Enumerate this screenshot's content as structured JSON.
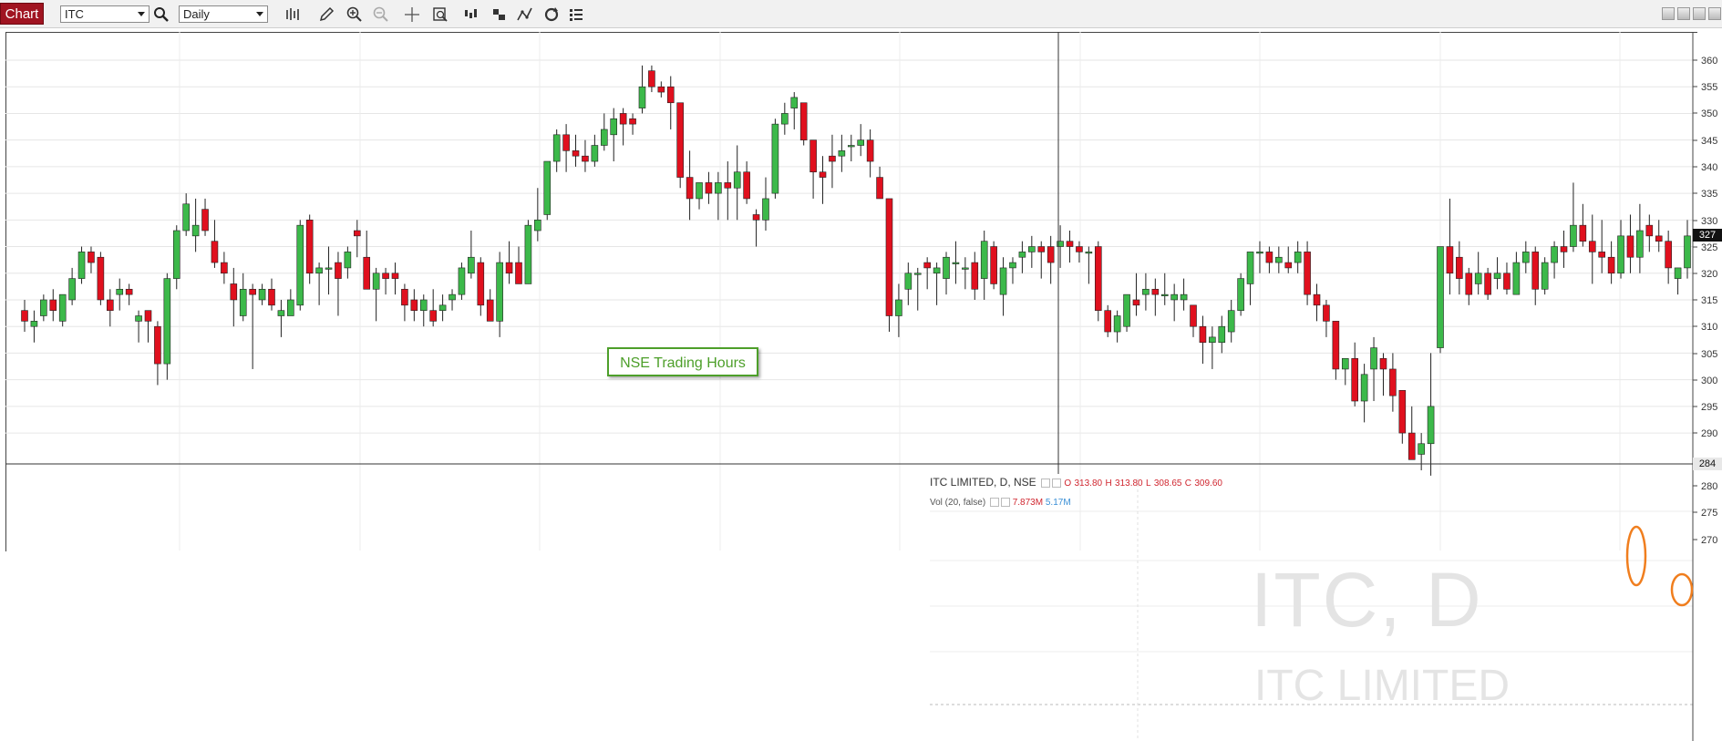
{
  "toolbar": {
    "chart_label": "Chart",
    "symbol_value": "ITC",
    "interval_value": "Daily",
    "tools": [
      "search-icon",
      "bar-type-icon",
      "pencil-icon",
      "zoom-in-icon",
      "zoom-out-icon",
      "crosshair-icon",
      "zoom-box-icon",
      "indicators-icon",
      "compare-icon",
      "drawing-icon",
      "refresh-icon",
      "list-icon"
    ]
  },
  "chart": {
    "annotation": "NSE Trading Hours",
    "last_price_tag": "327",
    "crosshair_price_tag": "284",
    "y_ticks": [
      "360",
      "355",
      "350",
      "345",
      "340",
      "335",
      "330",
      "325",
      "320",
      "315",
      "310",
      "305",
      "300",
      "295",
      "290",
      "280",
      "275",
      "270"
    ],
    "legend_title": "ITC LIMITED, D, NSE",
    "legend_o_label": "O",
    "legend_o": "313.80",
    "legend_h_label": "H",
    "legend_h": "313.80",
    "legend_l_label": "L",
    "legend_l": "308.65",
    "legend_c_label": "C",
    "legend_c": "309.60",
    "vol_label": "Vol (20, false)",
    "vol_a": "7.873M",
    "vol_b": "5.17M",
    "watermark_symbol": "ITC, D",
    "watermark_name": "ITC LIMITED",
    "colors": {
      "up": "#3cb94a",
      "down": "#e0101e",
      "highlight": "#f07e1e",
      "annotation": "#4d9f2a"
    }
  },
  "chart_data": {
    "type": "candlestick",
    "title": "ITC LIMITED, D, NSE",
    "ylim": [
      280,
      362
    ],
    "y_ticks": [
      270,
      275,
      280,
      290,
      295,
      300,
      305,
      310,
      315,
      320,
      325,
      330,
      335,
      340,
      345,
      350,
      355,
      360
    ],
    "candles": [
      [
        313,
        315,
        309,
        311
      ],
      [
        310,
        313,
        307,
        311
      ],
      [
        312,
        316,
        311,
        315
      ],
      [
        315,
        317,
        311,
        313
      ],
      [
        311,
        316,
        310,
        316
      ],
      [
        315,
        321,
        314,
        319
      ],
      [
        319,
        325,
        318,
        324
      ],
      [
        324,
        325,
        320,
        322
      ],
      [
        323,
        324,
        314,
        315
      ],
      [
        315,
        317,
        310,
        313
      ],
      [
        316,
        319,
        313,
        317
      ],
      [
        317,
        318,
        314,
        316
      ],
      [
        311,
        313,
        307,
        312
      ],
      [
        313,
        313,
        307,
        311
      ],
      [
        310,
        311,
        299,
        303
      ],
      [
        303,
        320,
        300,
        319
      ],
      [
        319,
        329,
        317,
        328
      ],
      [
        328,
        335,
        327,
        333
      ],
      [
        327,
        334,
        324,
        329
      ],
      [
        332,
        334,
        327,
        328
      ],
      [
        326,
        330,
        321,
        322
      ],
      [
        322,
        324,
        318,
        320
      ],
      [
        318,
        321,
        310,
        315
      ],
      [
        312,
        320,
        311,
        317
      ],
      [
        317,
        318,
        302,
        316
      ],
      [
        315,
        318,
        314,
        317
      ],
      [
        317,
        319,
        313,
        314
      ],
      [
        312,
        315,
        308,
        313
      ],
      [
        312,
        317,
        313,
        315
      ],
      [
        314,
        330,
        313,
        329
      ],
      [
        330,
        331,
        318,
        320
      ],
      [
        320,
        322,
        314,
        321
      ],
      [
        321,
        325,
        316,
        321
      ],
      [
        322,
        324,
        312,
        319
      ],
      [
        321,
        325,
        319,
        324
      ],
      [
        328,
        330,
        323,
        327
      ],
      [
        323,
        328,
        318,
        317
      ],
      [
        317,
        321,
        311,
        320
      ],
      [
        320,
        321,
        316,
        319
      ],
      [
        320,
        322,
        316,
        319
      ],
      [
        317,
        318,
        311,
        314
      ],
      [
        315,
        317,
        311,
        313
      ],
      [
        313,
        316,
        310,
        315
      ],
      [
        313,
        317,
        310,
        311
      ],
      [
        313,
        316,
        311,
        314
      ],
      [
        315,
        317,
        313,
        316
      ],
      [
        316,
        322,
        315,
        321
      ],
      [
        320,
        328,
        319,
        323
      ],
      [
        322,
        323,
        312,
        314
      ],
      [
        315,
        317,
        311,
        311
      ],
      [
        311,
        324,
        308,
        322
      ],
      [
        322,
        326,
        318,
        320
      ],
      [
        322,
        325,
        318,
        318
      ],
      [
        318,
        330,
        318,
        329
      ],
      [
        328,
        336,
        326,
        330
      ],
      [
        331,
        339,
        330,
        341
      ],
      [
        341,
        347,
        339,
        346
      ],
      [
        346,
        348,
        339,
        343
      ],
      [
        343,
        346,
        340,
        342
      ],
      [
        342,
        345,
        339,
        341
      ],
      [
        341,
        346,
        340,
        344
      ],
      [
        344,
        350,
        343,
        347
      ],
      [
        346,
        351,
        341,
        349
      ],
      [
        350,
        351,
        344,
        348
      ],
      [
        349,
        350,
        346,
        348
      ],
      [
        351,
        359,
        350,
        355
      ],
      [
        358,
        359,
        354,
        355
      ],
      [
        355,
        356,
        353,
        354
      ],
      [
        355,
        357,
        347,
        352
      ],
      [
        352,
        352,
        336,
        338
      ],
      [
        338,
        343,
        330,
        334
      ],
      [
        334,
        337,
        332,
        337
      ],
      [
        337,
        339,
        333,
        335
      ],
      [
        335,
        339,
        330,
        337
      ],
      [
        337,
        341,
        330,
        336
      ],
      [
        336,
        344,
        330,
        339
      ],
      [
        339,
        341,
        333,
        334
      ],
      [
        331,
        332,
        325,
        330
      ],
      [
        330,
        338,
        328,
        334
      ],
      [
        335,
        349,
        334,
        348
      ],
      [
        348,
        352,
        346,
        350
      ],
      [
        351,
        354,
        347,
        353
      ],
      [
        352,
        352,
        344,
        345
      ],
      [
        345,
        345,
        334,
        339
      ],
      [
        339,
        342,
        333,
        338
      ],
      [
        342,
        346,
        336,
        341
      ],
      [
        342,
        346,
        339,
        343
      ],
      [
        344,
        346,
        341,
        344
      ],
      [
        344,
        348,
        342,
        345
      ],
      [
        345,
        347,
        338,
        341
      ],
      [
        338,
        340,
        334,
        334
      ],
      [
        334,
        334,
        309,
        312
      ],
      [
        312,
        318,
        308,
        315
      ],
      [
        317,
        322,
        314,
        320
      ],
      [
        320,
        321,
        313,
        320
      ],
      [
        322,
        323,
        317,
        321
      ],
      [
        320,
        322,
        314,
        321
      ],
      [
        319,
        324,
        316,
        323
      ],
      [
        322,
        326,
        318,
        322
      ],
      [
        321,
        323,
        317,
        321
      ],
      [
        322,
        324,
        315,
        317
      ],
      [
        319,
        328,
        315,
        326
      ],
      [
        325,
        326,
        317,
        318
      ],
      [
        316,
        323,
        312,
        321
      ],
      [
        321,
        323,
        318,
        322
      ],
      [
        323,
        326,
        320,
        324
      ],
      [
        324,
        327,
        321,
        325
      ],
      [
        325,
        326,
        319,
        324
      ],
      [
        325,
        327,
        318,
        322
      ],
      [
        325,
        329,
        321,
        326
      ],
      [
        326,
        328,
        322,
        325
      ],
      [
        325,
        326,
        322,
        324
      ],
      [
        324,
        325,
        318,
        324
      ],
      [
        325,
        326,
        311,
        313
      ],
      [
        313,
        314,
        308,
        309
      ],
      [
        309,
        313,
        307,
        312
      ],
      [
        310,
        316,
        309,
        316
      ],
      [
        315,
        320,
        312,
        314
      ],
      [
        316,
        320,
        313,
        317
      ],
      [
        317,
        319,
        312,
        316
      ],
      [
        316,
        320,
        314,
        316
      ],
      [
        315,
        318,
        311,
        316
      ],
      [
        315,
        319,
        313,
        316
      ],
      [
        314,
        314,
        308,
        310
      ],
      [
        310,
        312,
        303,
        307
      ],
      [
        307,
        310,
        302,
        308
      ],
      [
        307,
        312,
        305,
        310
      ],
      [
        309,
        315,
        307,
        313
      ],
      [
        313,
        320,
        312,
        319
      ],
      [
        318,
        324,
        314,
        324
      ],
      [
        324,
        326,
        320,
        324
      ],
      [
        324,
        325,
        320,
        322
      ],
      [
        322,
        325,
        320,
        323
      ],
      [
        322,
        325,
        320,
        321
      ],
      [
        322,
        326,
        320,
        324
      ],
      [
        324,
        326,
        314,
        316
      ],
      [
        316,
        318,
        311,
        314
      ],
      [
        314,
        315,
        308,
        311
      ],
      [
        311,
        311,
        300,
        302
      ],
      [
        302,
        304,
        299,
        304
      ],
      [
        304,
        307,
        295,
        296
      ],
      [
        296,
        303,
        292,
        301
      ],
      [
        302,
        308,
        296,
        306
      ],
      [
        304,
        305,
        297,
        302
      ],
      [
        302,
        305,
        294,
        297
      ],
      [
        298,
        298,
        288,
        290
      ],
      [
        290,
        295,
        286,
        285
      ],
      [
        286,
        290,
        283,
        288
      ],
      [
        288,
        305,
        282,
        295
      ],
      [
        306,
        325,
        305,
        325
      ],
      [
        325,
        334,
        316,
        320
      ],
      [
        323,
        326,
        316,
        319
      ],
      [
        320,
        321,
        314,
        316
      ],
      [
        318,
        324,
        316,
        320
      ],
      [
        320,
        321,
        315,
        316
      ],
      [
        319,
        323,
        317,
        320
      ],
      [
        320,
        322,
        316,
        317
      ],
      [
        316,
        324,
        316,
        322
      ],
      [
        322,
        326,
        320,
        324
      ],
      [
        324,
        325,
        314,
        317
      ],
      [
        317,
        323,
        316,
        322
      ],
      [
        322,
        326,
        319,
        325
      ],
      [
        325,
        328,
        321,
        324
      ],
      [
        325,
        337,
        324,
        329
      ],
      [
        329,
        333,
        325,
        326
      ],
      [
        326,
        331,
        318,
        324
      ],
      [
        324,
        330,
        320,
        323
      ],
      [
        323,
        326,
        318,
        320
      ],
      [
        320,
        330,
        319,
        327
      ],
      [
        327,
        331,
        320,
        323
      ],
      [
        323,
        333,
        320,
        328
      ],
      [
        329,
        331,
        324,
        327
      ],
      [
        327,
        330,
        324,
        326
      ],
      [
        326,
        328,
        318,
        321
      ],
      [
        319,
        321,
        316,
        321
      ],
      [
        321,
        330,
        319,
        327
      ]
    ]
  }
}
